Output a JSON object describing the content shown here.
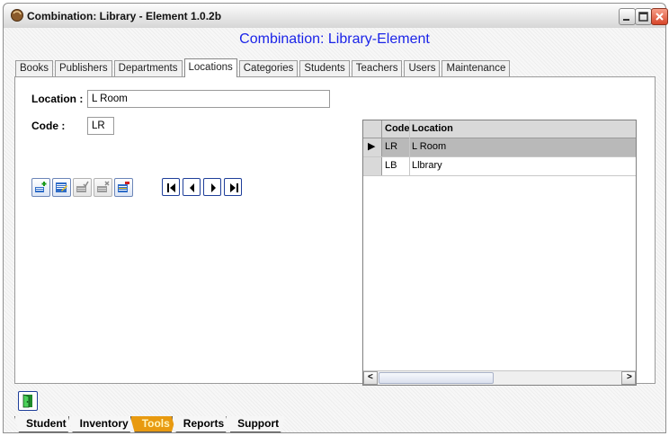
{
  "window": {
    "title": "Combination: Library - Element 1.0.2b"
  },
  "header": {
    "title": "Combination:  Library-Element",
    "color": "#1b24e8"
  },
  "tabs": [
    {
      "label": "Books"
    },
    {
      "label": "Publishers"
    },
    {
      "label": "Departments"
    },
    {
      "label": "Locations",
      "active": true
    },
    {
      "label": "Categories"
    },
    {
      "label": "Students"
    },
    {
      "label": "Teachers"
    },
    {
      "label": "Users"
    },
    {
      "label": "Maintenance"
    }
  ],
  "form": {
    "location_label": "Location :",
    "location_value": "L Room",
    "code_label": "Code :",
    "code_value": "LR"
  },
  "toolbar": {
    "buttons": [
      "add-record-icon",
      "edit-record-icon",
      "save-record-icon",
      "cancel-edit-icon",
      "delete-record-icon"
    ],
    "nav": [
      "first-record-icon",
      "previous-record-icon",
      "next-record-icon",
      "last-record-icon"
    ]
  },
  "grid": {
    "columns": [
      "Code",
      "Location"
    ],
    "rows": [
      {
        "code": "LR",
        "location": "L Room",
        "selected": true,
        "indicator": "▶"
      },
      {
        "code": "LB",
        "location": "Llbrary",
        "selected": false,
        "indicator": ""
      }
    ],
    "scroll_left": "<",
    "scroll_right": ">"
  },
  "bottom_tabs": [
    {
      "label": "Student"
    },
    {
      "label": "Inventory"
    },
    {
      "label": "Tools",
      "active": true
    },
    {
      "label": "Reports"
    },
    {
      "label": "Support"
    }
  ],
  "colors": {
    "accent_tab": "#e89a10",
    "selected_row": "#b9b9b9"
  }
}
